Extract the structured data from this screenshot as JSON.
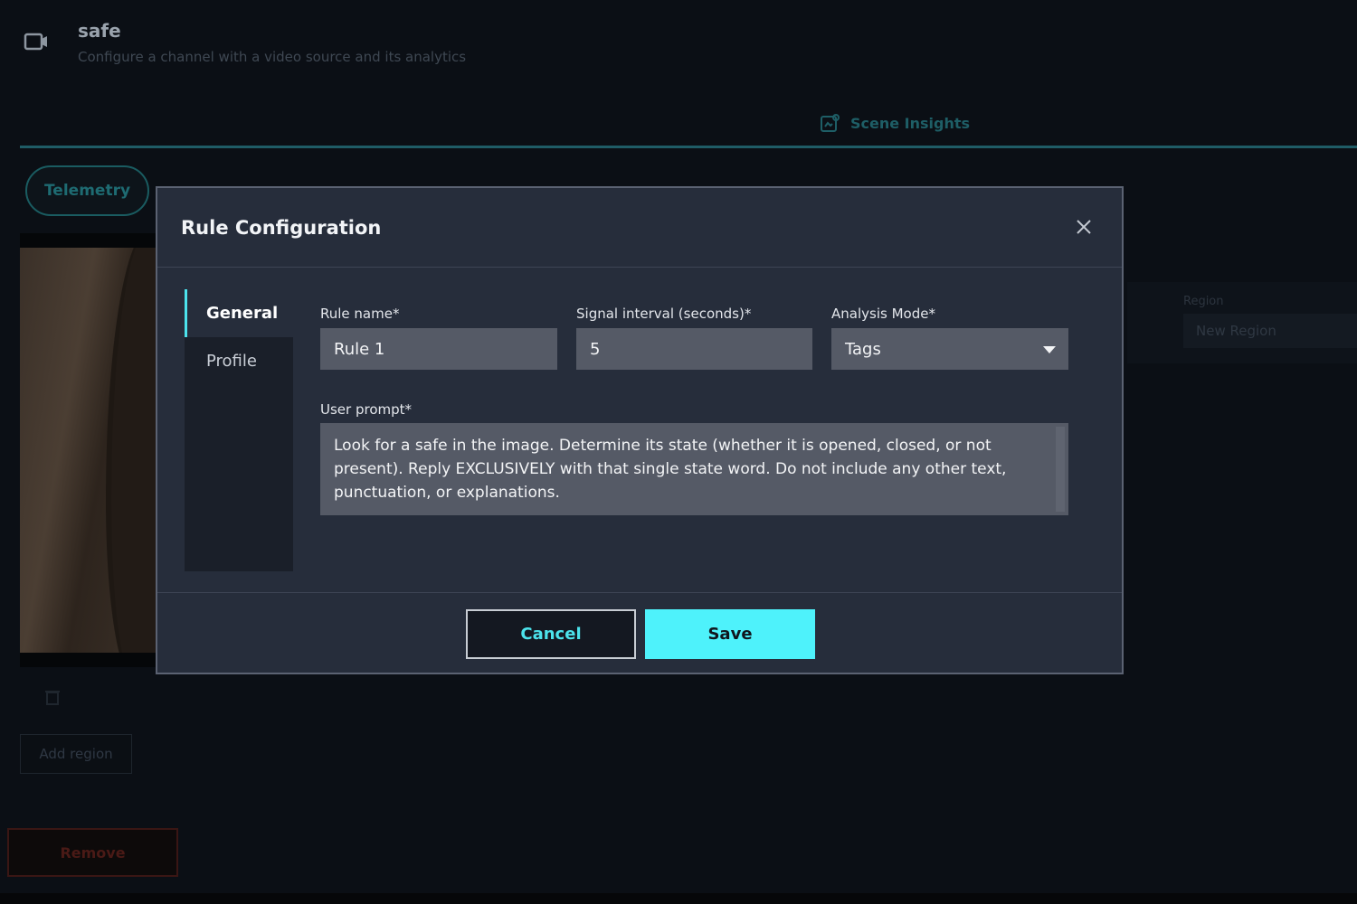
{
  "header": {
    "title": "safe",
    "subtitle": "Configure a channel with a video source and its analytics"
  },
  "tabs": {
    "scene_insights": "Scene Insights"
  },
  "sidebar": {
    "telemetry": "Telemetry",
    "add_region": "Add region",
    "remove": "Remove"
  },
  "region": {
    "label": "Region",
    "value": "New Region"
  },
  "modal": {
    "title": "Rule Configuration",
    "nav": [
      {
        "label": "General",
        "active": true
      },
      {
        "label": "Profile",
        "active": false
      }
    ],
    "fields": {
      "rule_name": {
        "label": "Rule name*",
        "value": "Rule 1"
      },
      "signal_interval": {
        "label": "Signal interval (seconds)*",
        "value": "5"
      },
      "analysis_mode": {
        "label": "Analysis Mode*",
        "value": "Tags"
      },
      "user_prompt": {
        "label": "User prompt*",
        "value": "Look for a safe in the image. Determine its state (whether it is opened, closed, or not present). Reply EXCLUSIVELY with that single state word. Do not include any other text, punctuation, or explanations."
      }
    },
    "buttons": {
      "cancel": "Cancel",
      "save": "Save"
    }
  },
  "colors": {
    "accent": "#4ef2fb",
    "modal_bg": "#262d3b",
    "field_bg": "#555a66",
    "page_bg": "#0b0f15"
  }
}
